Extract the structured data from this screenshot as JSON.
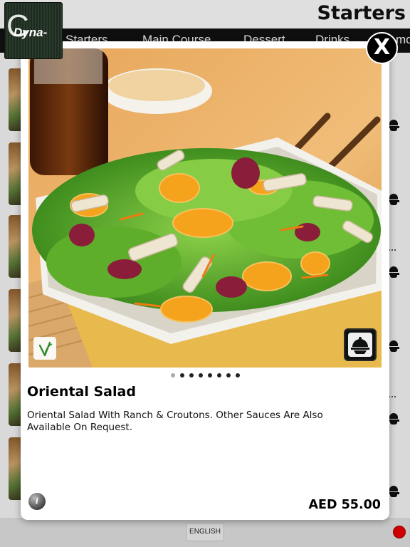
{
  "app": {
    "logo_text": "Dyna-",
    "page_title": "Starters"
  },
  "categories": [
    {
      "label": "Starters"
    },
    {
      "label": "Main Course"
    },
    {
      "label": "Dessert"
    },
    {
      "label": "Drinks"
    },
    {
      "label": "mo"
    }
  ],
  "modal": {
    "close_label": "X",
    "item_name": "Oriental Salad",
    "description": "Oriental Salad With Ranch & Croutons. Other Sauces Are Also Available On Request.",
    "price": "AED 55.00",
    "pager": {
      "count": 8,
      "active_index": 0
    },
    "badges": {
      "left": "vegetarian-icon",
      "right": "cloche-icon"
    },
    "info_label": "i"
  },
  "footer": {
    "language_label": "ENGLISH",
    "status_color": "#e00000"
  },
  "colors": {
    "category_bar": "#111111",
    "accent_status": "#e00000"
  }
}
